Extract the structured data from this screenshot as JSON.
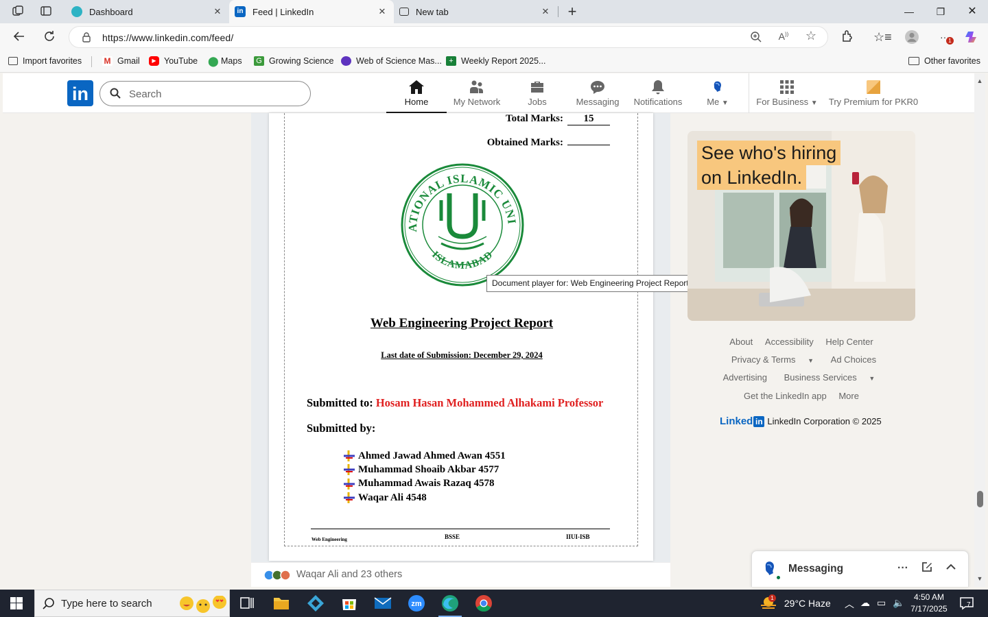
{
  "browser": {
    "tabs": [
      {
        "title": "Dashboard",
        "active": false
      },
      {
        "title": "Feed | LinkedIn",
        "active": true
      },
      {
        "title": "New tab",
        "active": false
      }
    ],
    "url": "https://www.linkedin.com/feed/",
    "favorites": [
      {
        "label": "Import favorites",
        "icon": "import-icon"
      },
      {
        "label": "Gmail",
        "icon": "gmail-icon"
      },
      {
        "label": "YouTube",
        "icon": "youtube-icon"
      },
      {
        "label": "Maps",
        "icon": "maps-pin-icon"
      },
      {
        "label": "Growing Science",
        "icon": "growing-science-icon"
      },
      {
        "label": "Web of Science Mas...",
        "icon": "web-of-science-icon"
      },
      {
        "label": "Weekly Report 2025...",
        "icon": "sheets-icon"
      }
    ],
    "other_favorites": "Other favorites",
    "extensions_badge": "1"
  },
  "linkedin": {
    "search_placeholder": "Search",
    "nav": [
      {
        "label": "Home",
        "icon": "home-icon",
        "active": true
      },
      {
        "label": "My Network",
        "icon": "network-icon",
        "active": false
      },
      {
        "label": "Jobs",
        "icon": "briefcase-icon",
        "active": false
      },
      {
        "label": "Messaging",
        "icon": "chat-icon",
        "active": false
      },
      {
        "label": "Notifications",
        "icon": "bell-icon",
        "active": false
      },
      {
        "label": "Me",
        "icon": "avatar-icon",
        "active": false
      }
    ],
    "for_business": "For Business",
    "premium": "Try Premium for PKR0"
  },
  "document": {
    "total_marks_label": "Total Marks:",
    "total_marks_value": "15",
    "obtained_marks_label": "Obtained Marks:",
    "seal_top_text": "INTERNATIONAL ISLAMIC UNIVERSITY",
    "seal_bottom_text": "ISLAMABAD",
    "title": "Web Engineering Project Report",
    "submission_date": "Last date of Submission:  December 29, 2024",
    "submitted_to_label": "Submitted to:",
    "submitted_to_name": "Hosam Hasan Mohammed Alhakami Professor",
    "submitted_by_label": "Submitted by:",
    "members": [
      "Ahmed Jawad Ahmed Awan 4551",
      "Muhammad Shoaib Akbar 4577",
      "Muhammad Awais Razaq 4578",
      "Waqar Ali 4548"
    ],
    "footer_left": "Web Engineering",
    "footer_center": "BSSE",
    "footer_right": "IIUI-ISB",
    "tooltip": "Document player for: Web Engineering Project Report"
  },
  "post": {
    "reactions_text": "Waqar Ali and 23 others"
  },
  "ad": {
    "headline_line1": "See who's hiring",
    "headline_line2": "on LinkedIn."
  },
  "footer": {
    "rows": [
      [
        "About",
        "Accessibility",
        "Help Center"
      ],
      [
        "Privacy & Terms",
        "Ad Choices"
      ],
      [
        "Advertising",
        "Business Services"
      ],
      [
        "Get the LinkedIn app",
        "More"
      ]
    ],
    "brand": "Linked",
    "brand_in": "in",
    "copyright": "LinkedIn Corporation © 2025"
  },
  "messaging": {
    "title": "Messaging"
  },
  "taskbar": {
    "search_placeholder": "Type here to search",
    "weather": "29°C  Haze",
    "weather_badge": "1",
    "time": "4:50 AM",
    "date": "7/17/2025",
    "notification_count": "7"
  }
}
